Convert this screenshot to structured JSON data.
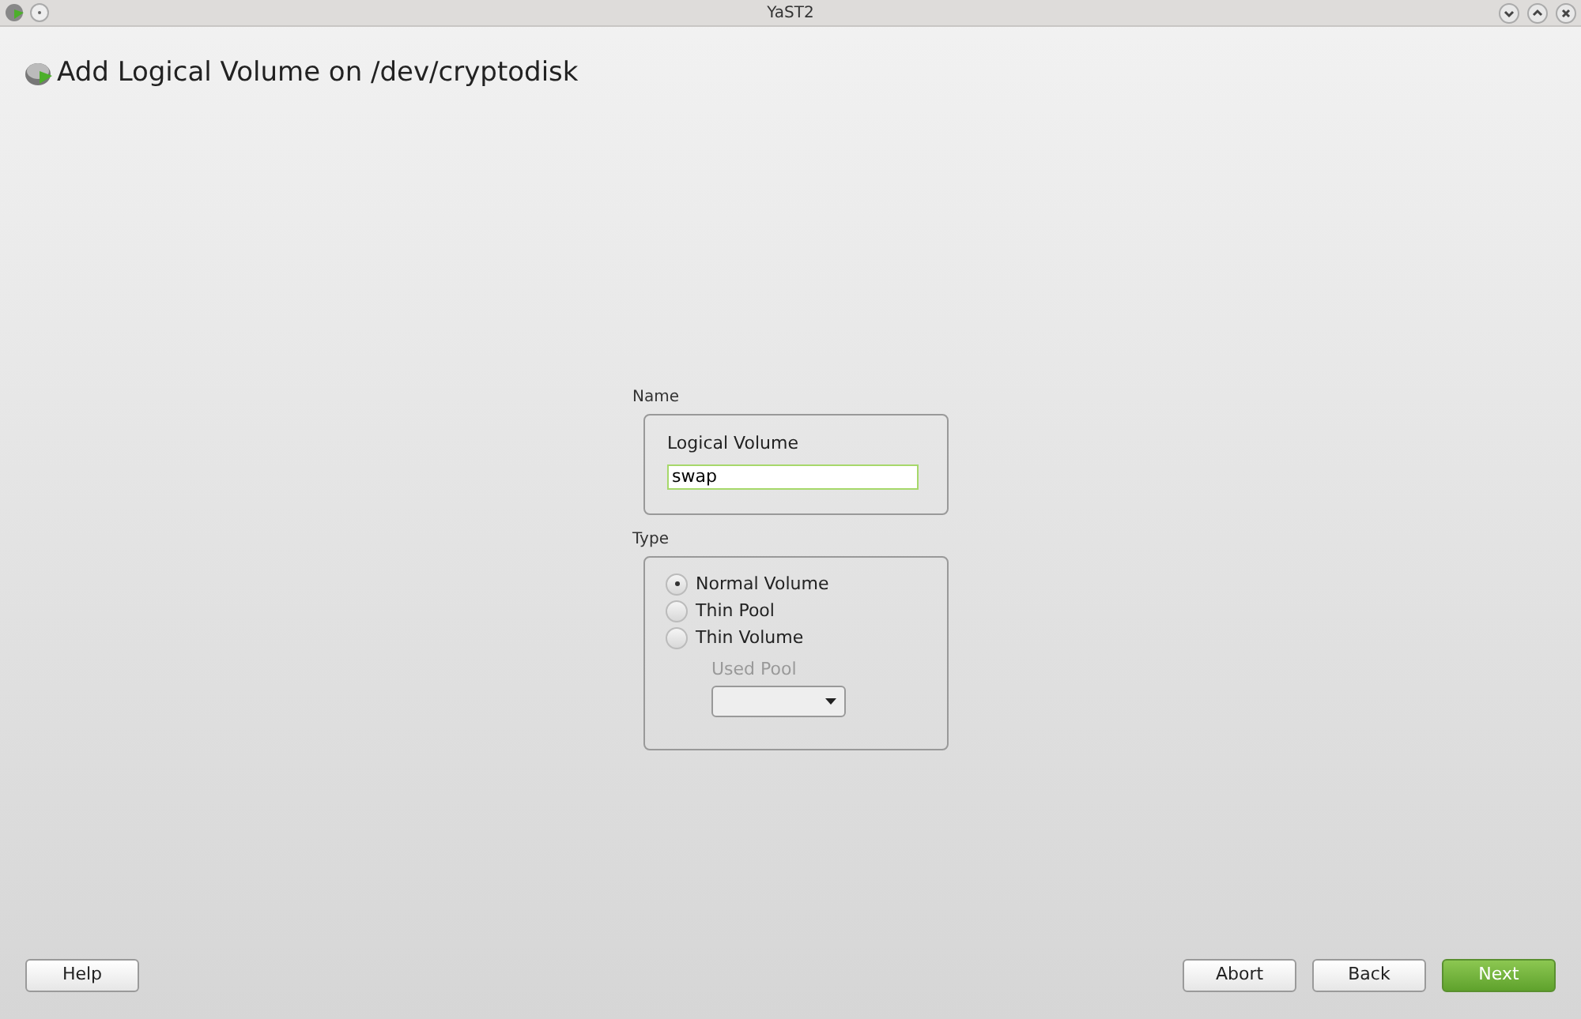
{
  "window": {
    "title": "YaST2"
  },
  "heading": "Add Logical Volume on /dev/cryptodisk",
  "name_group": {
    "label": "Name",
    "field_label": "Logical Volume",
    "value": "swap"
  },
  "type_group": {
    "label": "Type",
    "options": [
      {
        "label": "Normal Volume",
        "selected": true
      },
      {
        "label": "Thin Pool",
        "selected": false
      },
      {
        "label": "Thin Volume",
        "selected": false
      }
    ],
    "used_pool": {
      "label": "Used Pool",
      "disabled": true
    }
  },
  "buttons_left": [
    {
      "label": "Help",
      "kind": "normal"
    }
  ],
  "buttons_right": [
    {
      "label": "Abort",
      "kind": "normal"
    },
    {
      "label": "Back",
      "kind": "normal"
    },
    {
      "label": "Next",
      "kind": "primary"
    }
  ]
}
